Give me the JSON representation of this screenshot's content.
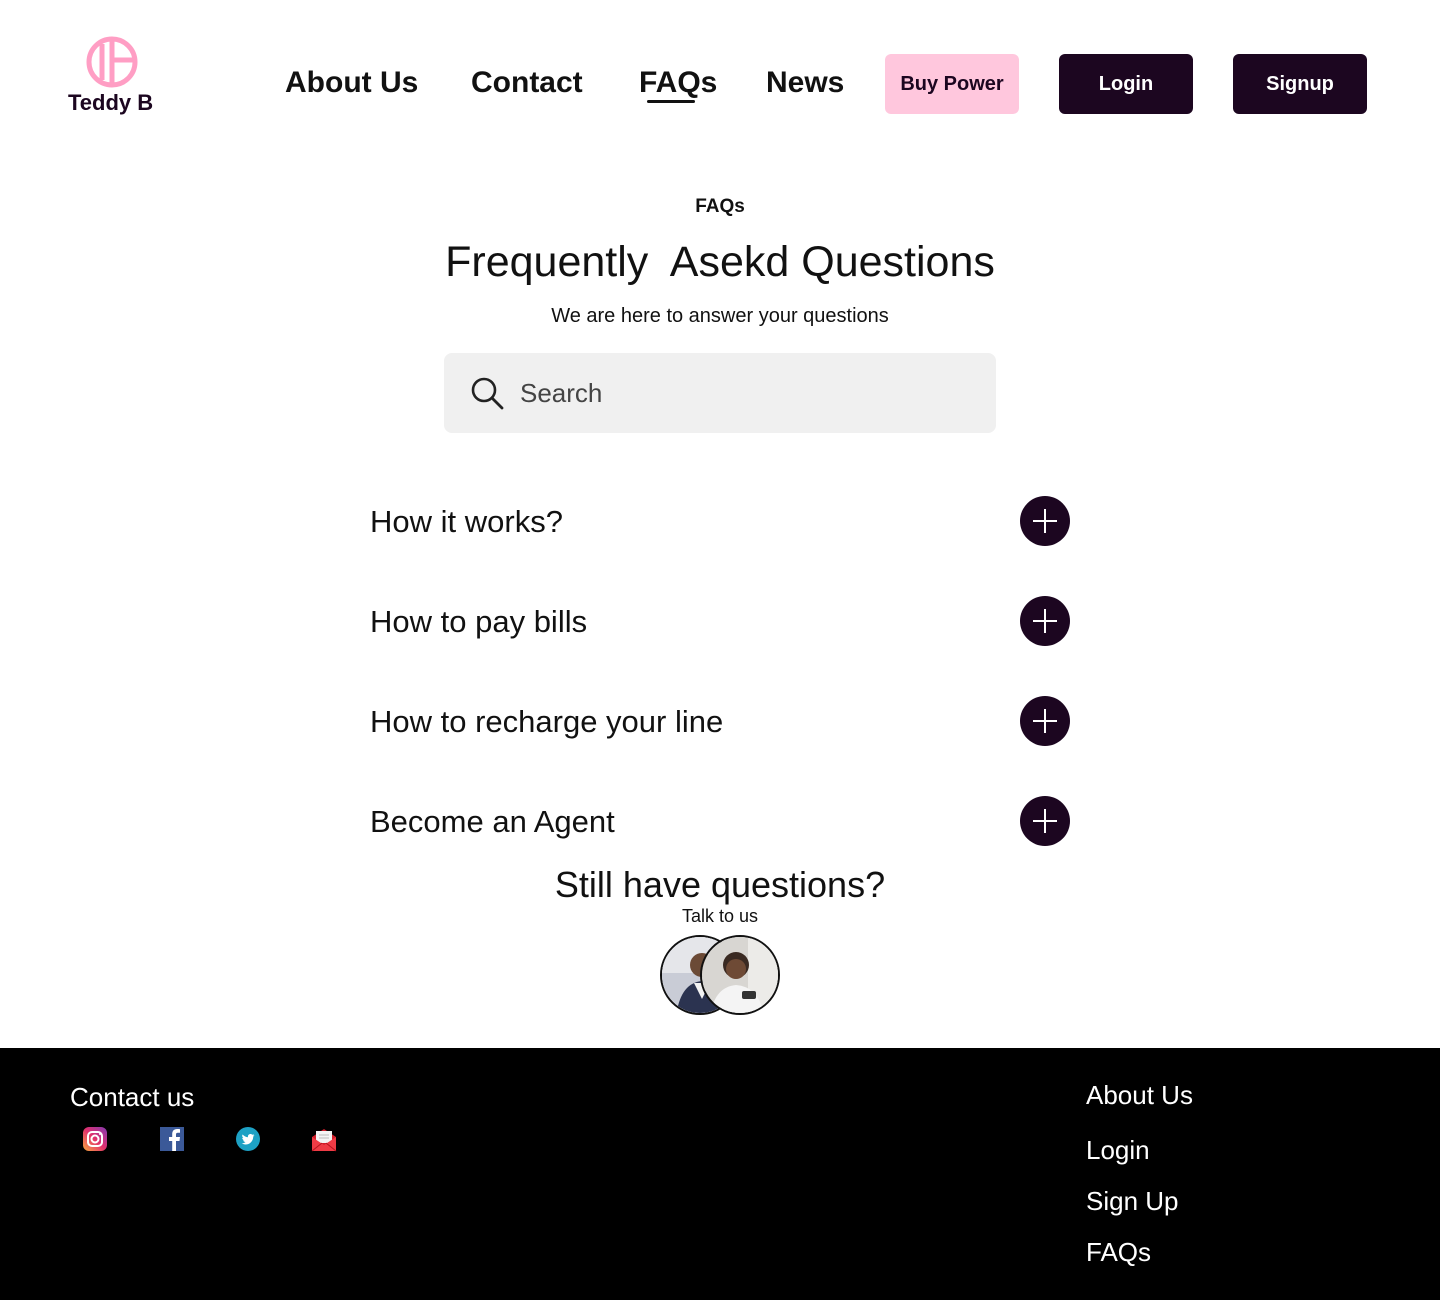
{
  "brand": {
    "name": "Teddy B",
    "logo_icon": "tb-monogram-icon",
    "accent_pink": "#ffc7dd",
    "dark_purple": "#1c0620"
  },
  "nav": {
    "links": [
      "About Us",
      "Contact",
      "FAQs",
      "News"
    ],
    "active": "FAQs",
    "buttons": {
      "buy_power": "Buy Power",
      "login": "Login",
      "signup": "Signup"
    }
  },
  "hero": {
    "eyebrow": "FAQs",
    "title": "Frequently  Asekd Questions",
    "subtitle": "We are here to answer your questions",
    "search": {
      "placeholder": "Search",
      "icon": "search-icon"
    }
  },
  "faqs": [
    {
      "question": "How it works?"
    },
    {
      "question": "How to pay bills"
    },
    {
      "question": "How to recharge your line"
    },
    {
      "question": "Become an Agent"
    }
  ],
  "contact_cta": {
    "heading": "Still have questions?",
    "link": "Talk to us"
  },
  "footer": {
    "contact_heading": "Contact us",
    "social_icons": [
      "instagram-icon",
      "facebook-icon",
      "twitter-icon",
      "email-icon"
    ],
    "links": [
      "About Us",
      "Login",
      "Sign Up",
      "FAQs"
    ],
    "background": "#000000"
  }
}
